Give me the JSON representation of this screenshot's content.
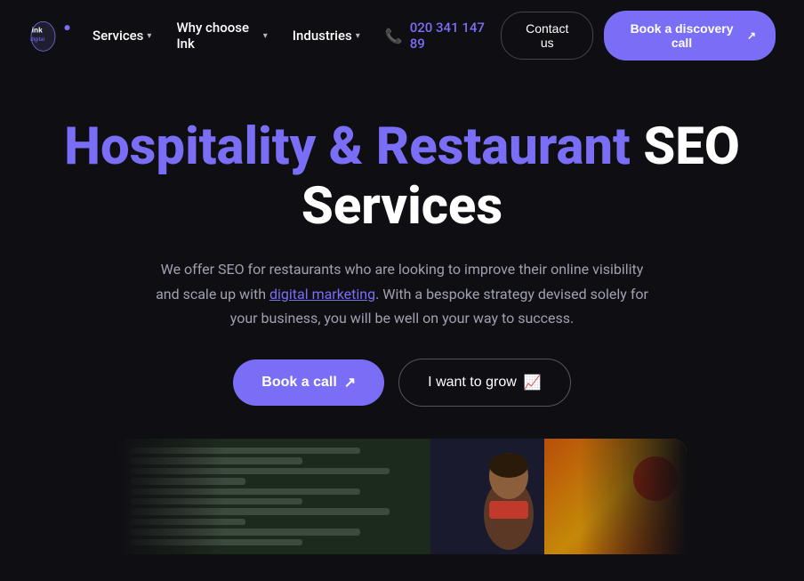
{
  "logo": {
    "alt": "Ink Digital"
  },
  "nav": {
    "items": [
      {
        "label": "Services",
        "hasDropdown": true
      },
      {
        "label": "Why choose Ink",
        "hasDropdown": true
      },
      {
        "label": "Industries",
        "hasDropdown": true
      }
    ],
    "phone": "020 341 147 89",
    "contact_label": "Contact us",
    "discovery_label": "Book a discovery call"
  },
  "hero": {
    "title_purple": "Hospitality & Restaurant",
    "title_white": "SEO Services",
    "subtitle_text1": "We offer SEO for restaurants who are looking to improve their online visibility and scale up with ",
    "subtitle_link": "digital marketing",
    "subtitle_text2": ". With a bespoke strategy devised solely for your business, you will be well on your way to success.",
    "btn_book": "Book a call",
    "btn_grow": "I want to grow"
  }
}
